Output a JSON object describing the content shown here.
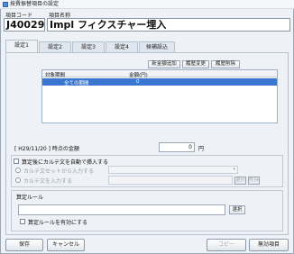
{
  "window": {
    "title": "按費振替項目の設定"
  },
  "header": {
    "code_label": "項目コード",
    "name_label": "項目名称",
    "code_value": "J40029",
    "name_value": "Impl フィクスチャー埋入"
  },
  "tabs": [
    {
      "label": "設定1"
    },
    {
      "label": "設定2"
    },
    {
      "label": "設定3"
    },
    {
      "label": "設定4"
    },
    {
      "label": "候補設込"
    }
  ],
  "grid_section": {
    "buttons": {
      "new": "新金額追加",
      "change": "履歴変更",
      "delete": "履歴削除"
    },
    "columns": [
      "対象期間",
      "金額(円)"
    ],
    "rows": [
      {
        "period": "全ての期間",
        "amount": "0"
      }
    ]
  },
  "as_of": {
    "label": "[ H29/11/20 ] 時点の金額",
    "value": "0",
    "unit": "円"
  },
  "karte": {
    "auto_insert_label": "算定後にカルテ文を自動で挿入する",
    "option1_label": "カルテ文セットから入力する",
    "option2_label": "カルテ文を入力する",
    "select_button": "選択",
    "delete_button": "削除"
  },
  "rule": {
    "title": "算定ルール",
    "select_button": "選択",
    "enable_label": "算定ルールを有効にする"
  },
  "footer": {
    "save": "保存",
    "cancel": "キャンセル",
    "copy": "コピー",
    "disable": "無効項目"
  }
}
